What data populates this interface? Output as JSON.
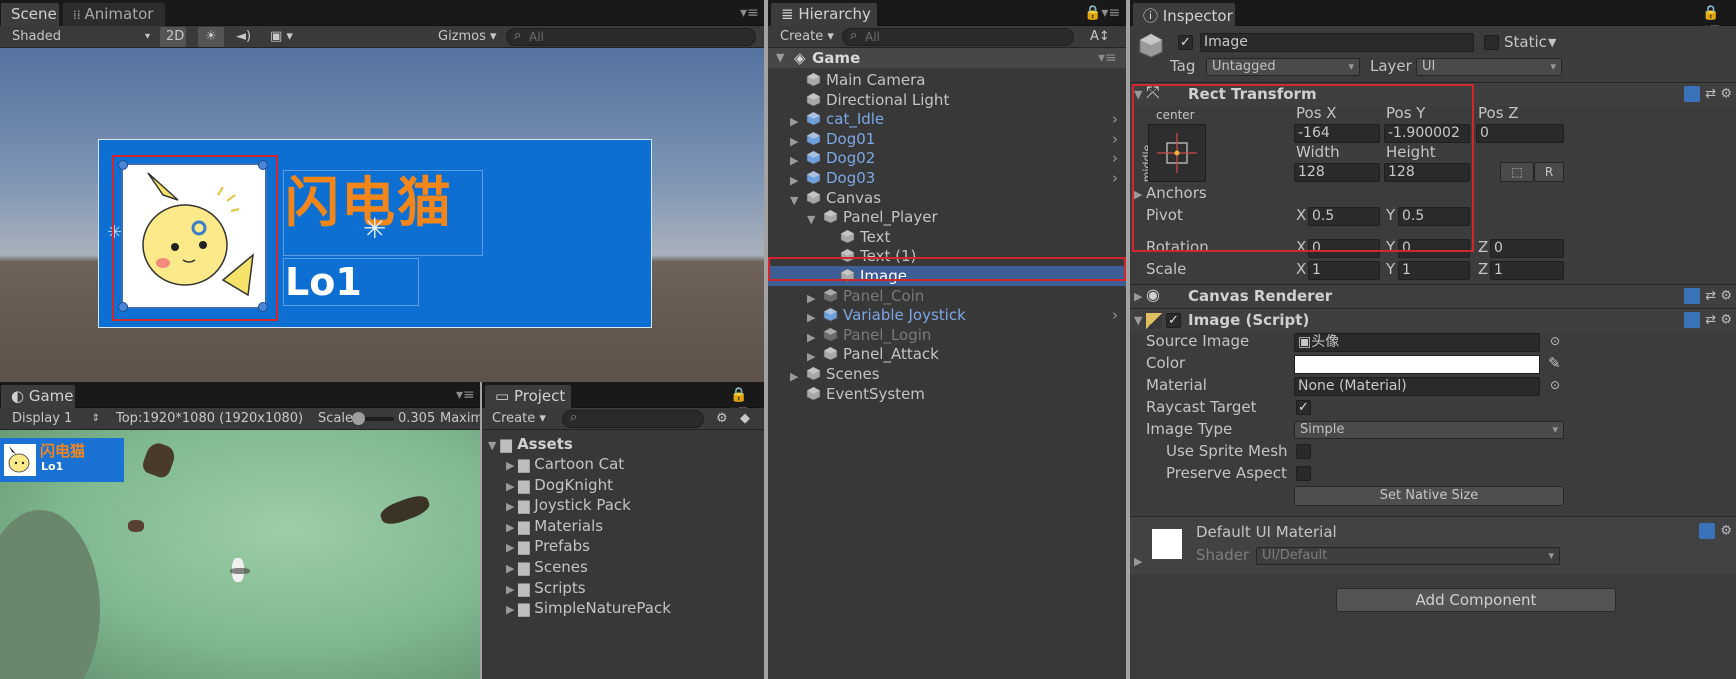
{
  "scene": {
    "tabs": [
      "Scene",
      "Animator"
    ],
    "toolbar": {
      "shading": "Shaded",
      "mode_2d": "2D",
      "gizmos": "Gizmos",
      "search_placeholder": "All"
    },
    "canvas_title": "闪电猫",
    "canvas_subtitle": "Lo1",
    "panel_color": "#0d6fd2",
    "title_color": "#f3861b"
  },
  "game": {
    "tab": "Game",
    "display": "Display 1",
    "resolution": "Top:1920*1080 (1920x1080)",
    "scale_label": "Scale",
    "scale_value": "0.305",
    "maximize": "Maximi",
    "hud_title": "闪电猫",
    "hud_level": "Lo1"
  },
  "project": {
    "tab": "Project",
    "create": "Create",
    "root": "Assets",
    "folders": [
      "Cartoon Cat",
      "DogKnight",
      "Joystick Pack",
      "Materials",
      "Prefabs",
      "Scenes",
      "Scripts",
      "SimpleNaturePack"
    ]
  },
  "hierarchy": {
    "tab": "Hierarchy",
    "create": "Create",
    "search_placeholder": "All",
    "scene_name": "Game",
    "items": [
      {
        "label": "Main Camera",
        "depth": 1,
        "kind": "plain"
      },
      {
        "label": "Directional Light",
        "depth": 1,
        "kind": "plain"
      },
      {
        "label": "cat_Idle",
        "depth": 1,
        "kind": "prefab",
        "fold": "right"
      },
      {
        "label": "Dog01",
        "depth": 1,
        "kind": "prefab",
        "fold": "right"
      },
      {
        "label": "Dog02",
        "depth": 1,
        "kind": "prefab",
        "fold": "right"
      },
      {
        "label": "Dog03",
        "depth": 1,
        "kind": "prefab",
        "fold": "right"
      },
      {
        "label": "Canvas",
        "depth": 1,
        "kind": "plain",
        "fold": "down"
      },
      {
        "label": "Panel_Player",
        "depth": 2,
        "kind": "plain",
        "fold": "down"
      },
      {
        "label": "Text",
        "depth": 3,
        "kind": "plain"
      },
      {
        "label": "Text (1)",
        "depth": 3,
        "kind": "plain"
      },
      {
        "label": "Image",
        "depth": 3,
        "kind": "selected"
      },
      {
        "label": "Panel_Coin",
        "depth": 2,
        "kind": "inactive",
        "fold": "right"
      },
      {
        "label": "Variable Joystick",
        "depth": 2,
        "kind": "prefab",
        "fold": "right"
      },
      {
        "label": "Panel_Login",
        "depth": 2,
        "kind": "inactive",
        "fold": "right"
      },
      {
        "label": "Panel_Attack",
        "depth": 2,
        "kind": "plain",
        "fold": "right"
      },
      {
        "label": "Scenes",
        "depth": 1,
        "kind": "plain",
        "fold": "right"
      },
      {
        "label": "EventSystem",
        "depth": 1,
        "kind": "plain"
      }
    ]
  },
  "inspector": {
    "tab": "Inspector",
    "object_name": "Image",
    "static_label": "Static",
    "tag_label": "Tag",
    "tag_value": "Untagged",
    "layer_label": "Layer",
    "layer_value": "UI",
    "rect_transform": {
      "title": "Rect Transform",
      "anchor_h": "center",
      "anchor_v": "middle",
      "pos_x_label": "Pos X",
      "pos_y_label": "Pos Y",
      "pos_z_label": "Pos Z",
      "pos_x": "-164",
      "pos_y": "-1.900002",
      "pos_z": "0",
      "width_label": "Width",
      "height_label": "Height",
      "width": "128",
      "height": "128",
      "anchors_label": "Anchors",
      "pivot_label": "Pivot",
      "pivot_x": "0.5",
      "pivot_y": "0.5",
      "rotation_label": "Rotation",
      "rot_x": "0",
      "rot_y": "0",
      "rot_z": "0",
      "scale_label": "Scale",
      "scale_x": "1",
      "scale_y": "1",
      "scale_z": "1",
      "btn_r": "R"
    },
    "canvas_renderer": {
      "title": "Canvas Renderer"
    },
    "image_script": {
      "title": "Image (Script)",
      "source_image_label": "Source Image",
      "source_image_value": "头像",
      "color_label": "Color",
      "material_label": "Material",
      "material_value": "None (Material)",
      "raycast_label": "Raycast Target",
      "image_type_label": "Image Type",
      "image_type_value": "Simple",
      "sprite_mesh_label": "Use Sprite Mesh",
      "preserve_label": "Preserve Aspect",
      "native_size_button": "Set Native Size"
    },
    "material": {
      "name": "Default UI Material",
      "shader_label": "Shader",
      "shader_value": "UI/Default"
    },
    "add_component": "Add Component"
  },
  "xyz": {
    "x": "X",
    "y": "Y",
    "z": "Z"
  }
}
